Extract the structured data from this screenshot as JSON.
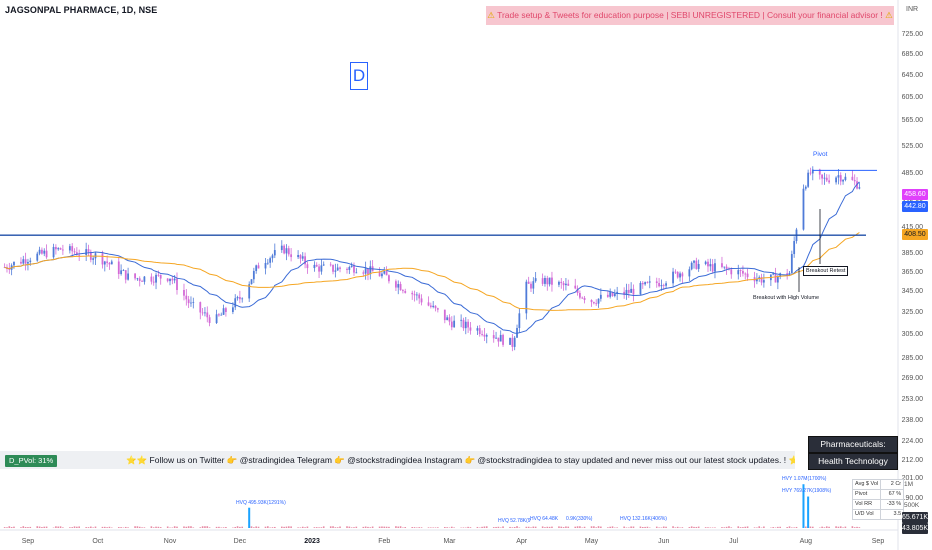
{
  "header": {
    "symbol": "JAGSONPAL PHARMACE, 1D, NSE",
    "currency": "INR",
    "timeframe_badge": "D",
    "banner_text": "Trade setup & Tweets for education purpose | SEBI UNREGISTERED | Consult your financial advisor !",
    "banner_warn_icon": "⚠"
  },
  "price_axis": {
    "labels": [
      "725.00",
      "685.00",
      "645.00",
      "605.00",
      "565.00",
      "525.00",
      "485.00",
      "445.00",
      "415.00",
      "385.00",
      "365.00",
      "345.00",
      "325.00",
      "305.00",
      "285.00",
      "269.00",
      "253.00",
      "238.00",
      "224.00",
      "212.00",
      "201.00",
      "190.00"
    ]
  },
  "price_tags": [
    {
      "text": "458.60",
      "bg": "#e040fb",
      "fg": "#ffffff"
    },
    {
      "text": "442.80",
      "bg": "#2962ff",
      "fg": "#ffffff"
    },
    {
      "text": "408.50",
      "bg": "#f5a623",
      "fg": "#131722"
    }
  ],
  "time_axis": {
    "labels": [
      "Sep",
      "Oct",
      "Nov",
      "Dec",
      "2023",
      "Feb",
      "Mar",
      "Apr",
      "May",
      "Jun",
      "Jul",
      "Aug",
      "Sep"
    ]
  },
  "chart_data": {
    "type": "candlestick",
    "title": "JAGSONPAL PHARMACE, 1D, NSE",
    "x_range": [
      "2022-08-22",
      "2023-08-30"
    ],
    "y_scale": "log",
    "ylim": [
      190,
      725
    ],
    "close_series_approx": {
      "dates": [
        "2022-08-22",
        "2022-09-01",
        "2022-09-15",
        "2022-10-01",
        "2022-10-15",
        "2022-11-01",
        "2022-11-10",
        "2022-11-20",
        "2022-12-01",
        "2022-12-10",
        "2022-12-20",
        "2023-01-01",
        "2023-01-10",
        "2023-01-20",
        "2023-02-01",
        "2023-02-15",
        "2023-03-01",
        "2023-03-15",
        "2023-03-28",
        "2023-04-03",
        "2023-04-10",
        "2023-04-20",
        "2023-05-01",
        "2023-05-15",
        "2023-06-01",
        "2023-06-15",
        "2023-07-01",
        "2023-07-15",
        "2023-07-25",
        "2023-07-31",
        "2023-08-03",
        "2023-08-08",
        "2023-08-15",
        "2023-08-24"
      ],
      "close": [
        372,
        382,
        392,
        384,
        360,
        362,
        333,
        318,
        340,
        378,
        392,
        372,
        370,
        372,
        363,
        342,
        318,
        310,
        298,
        352,
        358,
        352,
        338,
        345,
        358,
        375,
        368,
        358,
        366,
        470,
        488,
        478,
        485,
        472
      ]
    },
    "series": [
      {
        "name": "",
        "kind": "moving_average_short",
        "color": "#3b6bd6"
      },
      {
        "name": "",
        "kind": "moving_average_long",
        "color": "#f5a623"
      }
    ],
    "horizontal_levels": [
      {
        "price": 408,
        "color": "#1f4fa8",
        "label": ""
      },
      {
        "price": 492,
        "color": "#2962ff",
        "label": "Pivot"
      }
    ],
    "annotations": [
      "Pivot",
      "Breakout Retest",
      "Breakout with High Volume"
    ],
    "volume": {
      "axis_labels": [
        "1M",
        "500K"
      ],
      "current_labels": [
        {
          "text": "65.671K",
          "bg": "#2a2e39"
        },
        {
          "text": "43.805K",
          "bg": "#2a2e39"
        }
      ],
      "marker_labels": [
        "HVQ 495.93K(1291%)",
        "HVY 1.07M(1700%)",
        "HVY 769.27K(1908%)",
        "HVQ 132.16K(406%)",
        "HVQ 52.78K(9",
        "HVQ 64.48K",
        "0.9K(330%)"
      ],
      "peak_marks": [
        {
          "date": "2022-12-05",
          "volume_k": 496
        },
        {
          "date": "2023-07-31",
          "volume_k": 1070
        },
        {
          "date": "2023-08-02",
          "volume_k": 769
        }
      ]
    },
    "grid": false,
    "legend": "none"
  },
  "bottom_bar": {
    "pivot_badge": "D_PVol: 31%",
    "follow_text": "⭐⭐ Follow us on Twitter 👉 @stradingidea   Telegram 👉 @stockstradingidea   Instagram 👉 @stockstradingidea to stay updated and never miss out our latest stock updates. ! ⭐⭐"
  },
  "sector": {
    "industry": "Pharmaceuticals: Generic",
    "sector": "Health Technology"
  },
  "stats": [
    {
      "label": "Avg $ Vol",
      "value": "2 Cr"
    },
    {
      "label": "Pivot",
      "value": "67 %"
    },
    {
      "label": "Vol RR",
      "value": "-33 %"
    },
    {
      "label": "U/D Vol",
      "value": "3.5"
    }
  ],
  "colors": {
    "candle_up": "#4f7bd8",
    "candle_down": "#d36ad6",
    "ma_short": "#3b6bd6",
    "ma_long": "#f5a623",
    "breakout_line": "#1f4fa8",
    "volume_bar": "#e78aa4"
  }
}
